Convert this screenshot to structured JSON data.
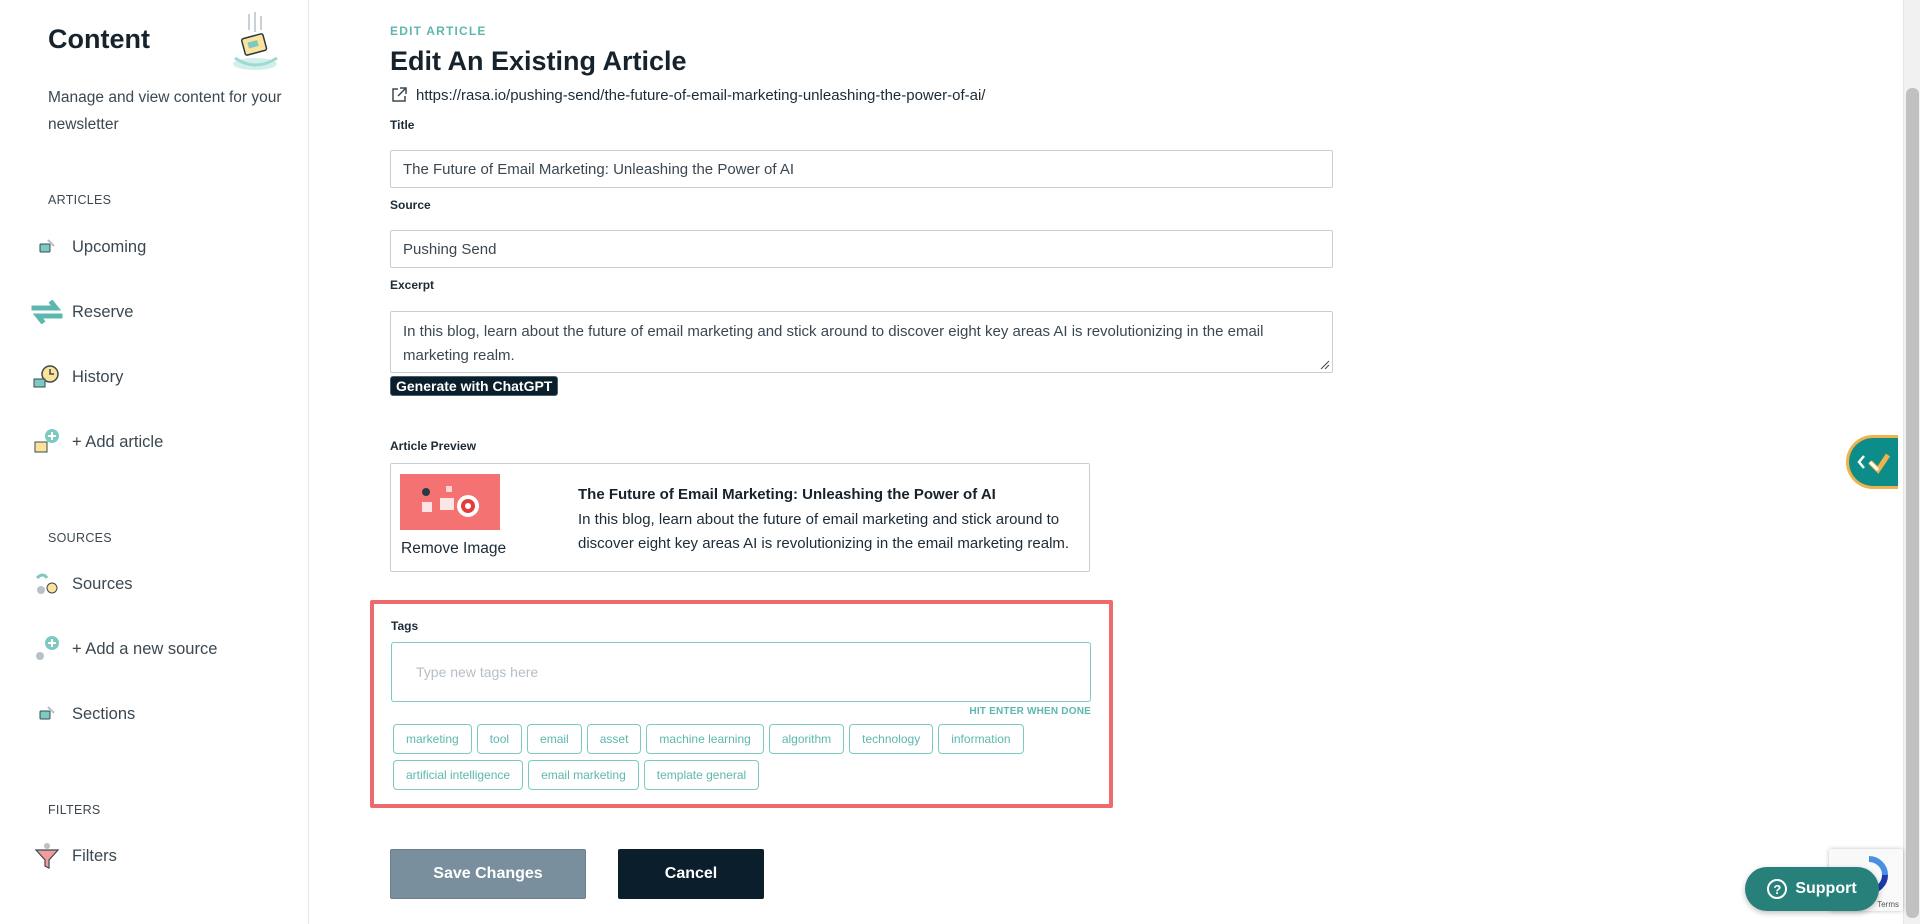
{
  "sidebar": {
    "title": "Content",
    "description": "Manage and view content for your newsletter",
    "sections": [
      {
        "heading": "ARTICLES",
        "items": [
          {
            "label": "Upcoming",
            "icon": "upcoming-icon"
          },
          {
            "label": "Reserve",
            "icon": "reserve-icon"
          },
          {
            "label": "History",
            "icon": "history-icon"
          },
          {
            "label": "+ Add article",
            "icon": "add-article-icon"
          }
        ]
      },
      {
        "heading": "SOURCES",
        "items": [
          {
            "label": "Sources",
            "icon": "sources-icon"
          },
          {
            "label": "+ Add a new source",
            "icon": "add-source-icon"
          },
          {
            "label": "Sections",
            "icon": "sections-icon"
          }
        ]
      },
      {
        "heading": "FILTERS",
        "items": [
          {
            "label": "Filters",
            "icon": "filter-funnel-icon"
          }
        ]
      }
    ]
  },
  "main": {
    "eyebrow": "EDIT ARTICLE",
    "title": "Edit An Existing Article",
    "url": "https://rasa.io/pushing-send/the-future-of-email-marketing-unleashing-the-power-of-ai/",
    "fields": {
      "title_label": "Title",
      "title_value": "The Future of Email Marketing: Unleashing the Power of AI",
      "source_label": "Source",
      "source_value": "Pushing Send",
      "excerpt_label": "Excerpt",
      "excerpt_value": "In this blog, learn about the future of email marketing and stick around to discover eight key areas AI is revolutionizing in the email marketing realm."
    },
    "generate_button": "Generate with ChatGPT",
    "preview": {
      "label": "Article Preview",
      "remove_image": "Remove Image",
      "title": "The Future of Email Marketing: Unleashing the Power of AI",
      "excerpt": "In this blog, learn about the future of email marketing and stick around to discover eight key areas AI is revolutionizing in the email marketing realm."
    },
    "tags": {
      "label": "Tags",
      "placeholder": "Type new tags here",
      "hint": "HIT ENTER WHEN DONE",
      "items": [
        "marketing",
        "tool",
        "email",
        "asset",
        "machine learning",
        "algorithm",
        "technology",
        "information",
        "artificial intelligence",
        "email marketing",
        "template general"
      ]
    },
    "save_button": "Save Changes",
    "cancel_button": "Cancel"
  },
  "widgets": {
    "support_label": "Support",
    "recaptcha_terms": "Terms"
  },
  "colors": {
    "accent": "#5cb8ae",
    "highlight_border": "#ef6a6a",
    "dark": "#0b1e2b",
    "save_button": "#7a8f9e"
  }
}
